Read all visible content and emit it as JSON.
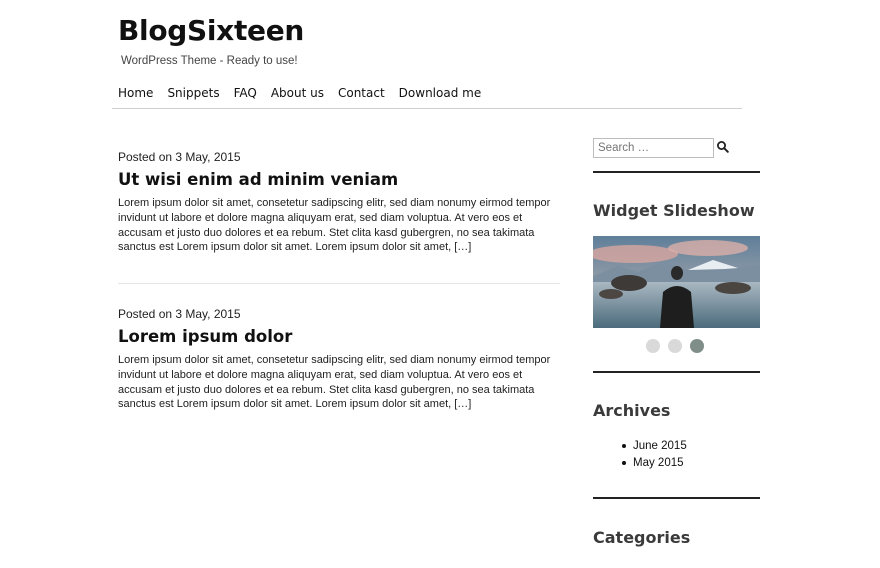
{
  "site": {
    "title": "BlogSixteen",
    "description": "WordPress Theme - Ready to use!"
  },
  "nav": {
    "items": [
      "Home",
      "Snippets",
      "FAQ",
      "About us",
      "Contact",
      "Download me"
    ]
  },
  "posts": [
    {
      "meta": "Posted on 3 May, 2015",
      "title": "Ut wisi enim ad minim veniam",
      "excerpt": "Lorem ipsum dolor sit amet, consetetur sadipscing elitr, sed diam nonumy eirmod tempor invidunt ut labore et dolore magna aliquyam erat, sed diam voluptua. At vero eos et accusam et justo duo dolores et ea rebum. Stet clita kasd gubergren, no sea takimata sanctus est Lorem ipsum dolor sit amet. Lorem ipsum dolor sit amet, […]"
    },
    {
      "meta": "Posted on 3 May, 2015",
      "title": "Lorem ipsum dolor",
      "excerpt": "Lorem ipsum dolor sit amet, consetetur sadipscing elitr, sed diam nonumy eirmod tempor invidunt ut labore et dolore magna aliquyam erat, sed diam voluptua. At vero eos et accusam et justo duo dolores et ea rebum. Stet clita kasd gubergren, no sea takimata sanctus est Lorem ipsum dolor sit amet. Lorem ipsum dolor sit amet, […]"
    }
  ],
  "sidebar": {
    "search": {
      "placeholder": "Search …",
      "icon": "search-icon"
    },
    "slideshow": {
      "title": "Widget Slideshow",
      "slides": 3,
      "active_index": 2
    },
    "archives": {
      "title": "Archives",
      "items": [
        "June 2015",
        "May 2015"
      ]
    },
    "categories": {
      "title": "Categories"
    }
  },
  "colors": {
    "text": "#111111",
    "widget_title": "#3a3a3a",
    "rule": "#222222",
    "dot": "#d9d9d9",
    "dot_active": "#7f8e89"
  }
}
